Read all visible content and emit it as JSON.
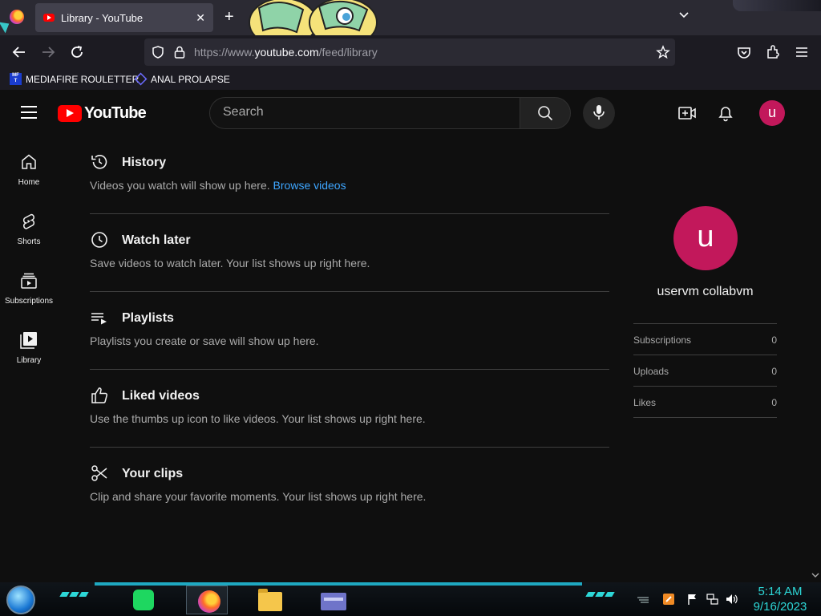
{
  "browser": {
    "tab_title": "Library - YouTube",
    "url_prefix": "https://www.",
    "url_domain": "youtube.com",
    "url_path": "/feed/library",
    "bookmarks": [
      {
        "label": "MEDIAFIRE ROULETTER",
        "icon": "mediafire-icon",
        "icon_text": "MF\nT"
      },
      {
        "label": "ANAL PROLAPSE",
        "icon": "bookmark-shape-icon"
      }
    ]
  },
  "header": {
    "logo_text": "YouTube",
    "search_placeholder": "Search",
    "avatar_letter": "u"
  },
  "sidebar": {
    "items": [
      {
        "label": "Home",
        "icon": "home-icon"
      },
      {
        "label": "Shorts",
        "icon": "shorts-icon"
      },
      {
        "label": "Subscriptions",
        "icon": "subscriptions-icon"
      },
      {
        "label": "Library",
        "icon": "library-icon"
      }
    ]
  },
  "library": {
    "sections": [
      {
        "title": "History",
        "desc": "Videos you watch will show up here.",
        "link": "Browse videos",
        "icon": "history-icon"
      },
      {
        "title": "Watch later",
        "desc": "Save videos to watch later. Your list shows up right here.",
        "icon": "clock-icon"
      },
      {
        "title": "Playlists",
        "desc": "Playlists you create or save will show up here.",
        "icon": "playlist-icon"
      },
      {
        "title": "Liked videos",
        "desc": "Use the thumbs up icon to like videos. Your list shows up right here.",
        "icon": "thumbs-up-icon"
      },
      {
        "title": "Your clips",
        "desc": "Clip and share your favorite moments. Your list shows up right here.",
        "icon": "scissors-icon"
      }
    ]
  },
  "profile": {
    "avatar_letter": "u",
    "name": "uservm collabvm",
    "stats": [
      {
        "label": "Subscriptions",
        "value": "0"
      },
      {
        "label": "Uploads",
        "value": "0"
      },
      {
        "label": "Likes",
        "value": "0"
      }
    ]
  },
  "taskbar": {
    "time": "5:14 AM",
    "date": "9/16/2023"
  },
  "colors": {
    "accent_red": "#ff0000",
    "avatar": "#c2185b",
    "link": "#3ea6ff",
    "clock": "#2dd7d7"
  }
}
